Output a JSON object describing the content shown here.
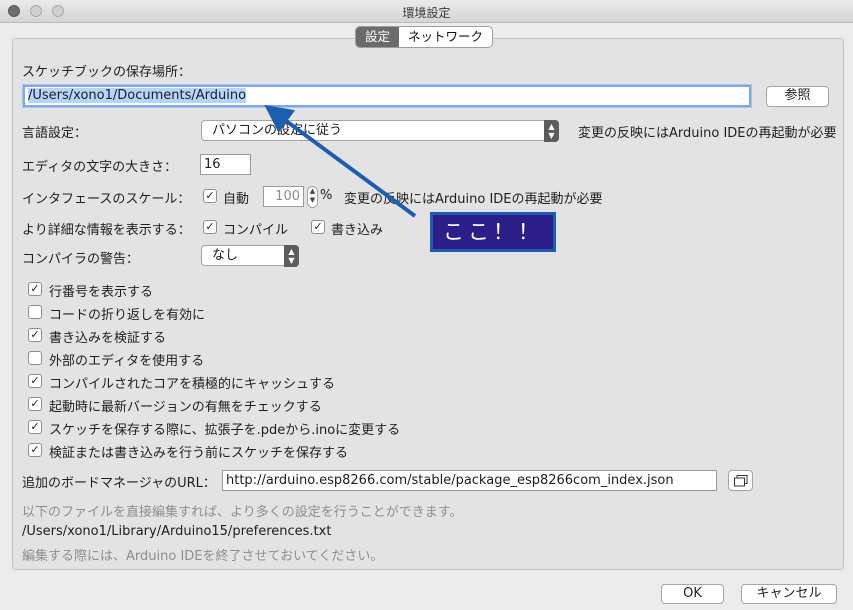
{
  "window": {
    "title": "環境設定"
  },
  "tabs": [
    {
      "label": "設定"
    },
    {
      "label": "ネットワーク"
    }
  ],
  "sketchbook": {
    "label": "スケッチブックの保存場所：",
    "value": "/Users/xono1/Documents/Arduino",
    "browse": "参照"
  },
  "language": {
    "label": "言語設定：",
    "selected": "パソコンの設定に従う",
    "note": "変更の反映にはArduino IDEの再起動が必要"
  },
  "font_size": {
    "label": "エディタの文字の大きさ：",
    "value": "16"
  },
  "scale": {
    "label": "インタフェースのスケール：",
    "auto_label": "自動",
    "auto_checked": true,
    "value": "100",
    "unit": "%",
    "note": "変更の反映にはArduino IDEの再起動が必要"
  },
  "verbose": {
    "label": "より詳細な情報を表示する：",
    "compile_label": "コンパイル",
    "compile_checked": true,
    "upload_label": "書き込み",
    "upload_checked": true
  },
  "warnings": {
    "label": "コンパイラの警告：",
    "selected": "なし"
  },
  "options": [
    {
      "label": "行番号を表示する",
      "checked": true
    },
    {
      "label": "コードの折り返しを有効に",
      "checked": false
    },
    {
      "label": "書き込みを検証する",
      "checked": true
    },
    {
      "label": "外部のエディタを使用する",
      "checked": false
    },
    {
      "label": "コンパイルされたコアを積極的にキャッシュする",
      "checked": true
    },
    {
      "label": "起動時に最新バージョンの有無をチェックする",
      "checked": true
    },
    {
      "label": "スケッチを保存する際に、拡張子を.pdeから.inoに変更する",
      "checked": true
    },
    {
      "label": "検証または書き込みを行う前にスケッチを保存する",
      "checked": true
    }
  ],
  "boards_url": {
    "label": "追加のボードマネージャのURL：",
    "value": "http://arduino.esp8266.com/stable/package_esp8266com_index.json",
    "icon": "window-list-icon"
  },
  "info": {
    "more_prefs": "以下のファイルを直接編集すれば、より多くの設定を行うことができます。",
    "path": "/Users/xono1/Library/Arduino15/preferences.txt",
    "edit_note": "編集する際には、Arduino IDEを終了させておいてください。"
  },
  "buttons": {
    "ok": "OK",
    "cancel": "キャンセル"
  },
  "annotation": {
    "text": "ここ！！",
    "color": "#2c1e88",
    "arrow_color": "#1e5eb0"
  }
}
